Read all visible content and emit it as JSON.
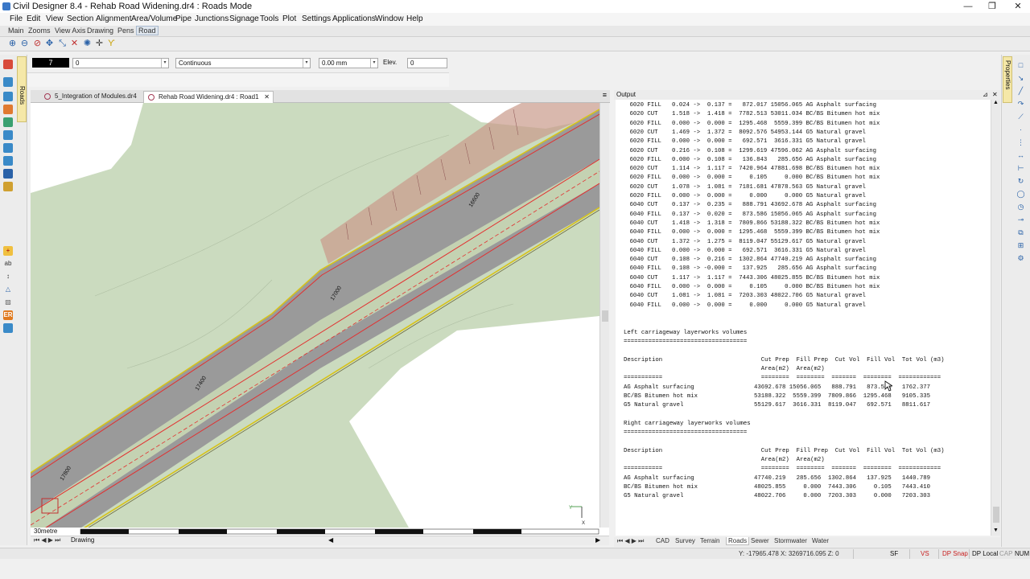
{
  "window": {
    "title": "Civil Designer 8.4 - Rehab Road Widening.dr4 : Roads Mode",
    "minimize": "—",
    "restore": "❐",
    "close": "✕"
  },
  "menu": [
    "File",
    "Edit",
    "View",
    "Section",
    "Alignment",
    "Area/Volume",
    "Pipe",
    "Junctions",
    "Signage",
    "Tools",
    "Plot",
    "Settings",
    "Applications",
    "Window",
    "Help"
  ],
  "subtoolbar": [
    "Main",
    "Zooms",
    "View Axis",
    "Drawing",
    "Pens",
    "Road"
  ],
  "subtoolbar_active": "Road",
  "toolbar_icons": [
    "zoom-in-icon",
    "zoom-out-icon",
    "zoom-window-icon",
    "pan-icon",
    "zoom-extents-icon",
    "zoom-previous-icon",
    "refresh-icon",
    "snap-icon",
    "filter-icon"
  ],
  "properties_bar": {
    "pen_number": "7",
    "layer_value": "0",
    "line_type": "Continuous",
    "line_width": "0.00 mm",
    "elev_label": "Elev.",
    "elev_value": "0"
  },
  "side_tabs": {
    "left": "Roads",
    "right": "Properties"
  },
  "document_tabs": [
    {
      "label": "5_Integration of Modules.dr4",
      "active": false
    },
    {
      "label": "Rehab Road Widening.dr4 : Road1",
      "active": true
    }
  ],
  "drawing": {
    "chainage_labels": [
      "16600",
      "17000",
      "17400",
      "17800"
    ],
    "scale_label": "30metre",
    "bottom_tab": "Drawing",
    "axis_x": "X",
    "axis_y": "Y"
  },
  "output": {
    "panel_title": "Output",
    "rows": [
      "    6020 FILL   0.024 ->  0.137 =   872.017 15056.065 AG Asphalt surfacing",
      "    6020 CUT    1.518 ->  1.418 =  7782.513 53011.034 BC/BS Bitumen hot mix",
      "    6020 FILL   0.000 ->  0.000 =  1295.468  5559.399 BC/BS Bitumen hot mix",
      "    6020 CUT    1.469 ->  1.372 =  8092.576 54953.144 G5 Natural gravel",
      "    6020 FILL   0.000 ->  0.000 =   692.571  3616.331 G5 Natural gravel",
      "    6020 CUT    0.216 ->  0.108 =  1299.619 47596.062 AG Asphalt surfacing",
      "    6020 FILL   0.000 ->  0.108 =   136.843   285.656 AG Asphalt surfacing",
      "    6020 CUT    1.114 ->  1.117 =  7420.964 47881.698 BC/BS Bitumen hot mix",
      "    6020 FILL   0.000 ->  0.000 =     0.105     0.000 BC/BS Bitumen hot mix",
      "    6020 CUT    1.078 ->  1.081 =  7181.681 47878.563 G5 Natural gravel",
      "    6020 FILL   0.000 ->  0.000 =     0.000     0.000 G5 Natural gravel",
      "    6040 CUT    0.137 ->  0.235 =   888.791 43692.678 AG Asphalt surfacing",
      "    6040 FILL   0.137 ->  0.020 =   873.586 15056.065 AG Asphalt surfacing",
      "    6040 CUT    1.418 ->  1.318 =  7809.866 53188.322 BC/BS Bitumen hot mix",
      "    6040 FILL   0.000 ->  0.000 =  1295.468  5559.399 BC/BS Bitumen hot mix",
      "    6040 CUT    1.372 ->  1.275 =  8119.047 55129.617 G5 Natural gravel",
      "    6040 FILL   0.000 ->  0.000 =   692.571  3616.331 G5 Natural gravel",
      "    6040 CUT    0.108 ->  0.216 =  1302.864 47740.219 AG Asphalt surfacing",
      "    6040 FILL   0.108 -> -0.000 =   137.925   285.656 AG Asphalt surfacing",
      "    6040 CUT    1.117 ->  1.117 =  7443.306 48025.855 BC/BS Bitumen hot mix",
      "    6040 FILL   0.000 ->  0.000 =     0.105     0.000 BC/BS Bitumen hot mix",
      "    6040 CUT    1.081 ->  1.081 =  7203.303 48022.706 G5 Natural gravel",
      "    6040 FILL   0.000 ->  0.000 =     0.000     0.000 G5 Natural gravel"
    ],
    "left_title": "Left carriageway layerworks volumes",
    "right_title": "Right carriageway layerworks volumes",
    "title_underline": "===================================",
    "header_line1": "Description                            Cut Prep  Fill Prep  Cut Vol  Fill Vol  Tot Vol (m3)",
    "header_line2": "                                       Area(m2)  Area(m2)",
    "header_rule": "===========                            ========  ========  =======  ========  ============",
    "left_rows": [
      "AG Asphalt surfacing                 43692.678 15056.065   888.791   873.586   1762.377",
      "BC/BS Bitumen hot mix                53188.322  5559.399  7809.866  1295.468   9105.335",
      "G5 Natural gravel                    55129.617  3616.331  8119.047   692.571   8811.617"
    ],
    "right_rows": [
      "AG Asphalt surfacing                 47740.219   285.656  1302.864   137.925   1440.789",
      "BC/BS Bitumen hot mix                48025.855     0.000  7443.306     0.105   7443.410",
      "G5 Natural gravel                    48022.706     0.000  7203.303     0.000   7203.303"
    ]
  },
  "output_tabs": [
    "CAD",
    "Survey",
    "Terrain",
    "Roads",
    "Sewer",
    "Stormwater",
    "Water"
  ],
  "output_tabs_active": "Roads",
  "status": {
    "coords": "Y: -17965.478 X: 3269716.095 Z: 0",
    "sf": "SF",
    "vs": "VS",
    "dp_snap": "DP Snap",
    "dp_local": "DP Local",
    "cap": "CAP",
    "num": "NUM"
  },
  "colors": {
    "terrain": "#cbdbbf",
    "road": "#999999",
    "redline": "#e23030",
    "yellowline": "#d6c21a",
    "status_red": "#c81e1e"
  }
}
